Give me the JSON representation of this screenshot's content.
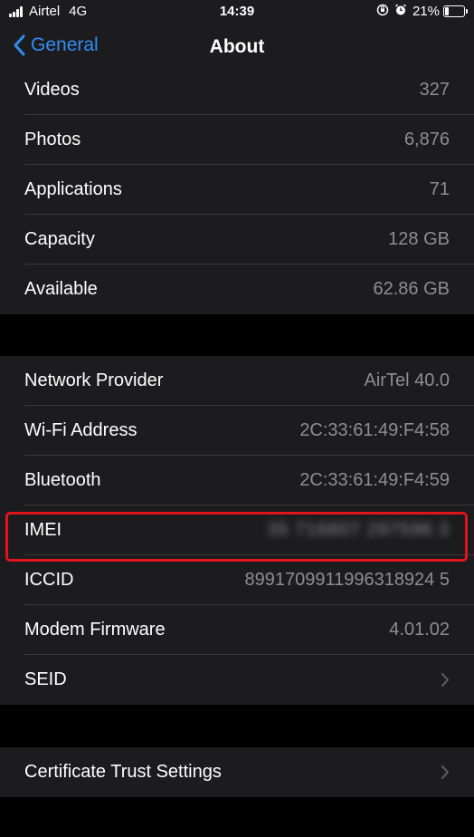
{
  "status_bar": {
    "carrier": "Airtel",
    "network": "4G",
    "time": "14:39",
    "battery_percent": "21%",
    "battery_level": 0.21
  },
  "nav": {
    "back_label": "General",
    "title": "About"
  },
  "storage_group": [
    {
      "label": "Videos",
      "value": "327"
    },
    {
      "label": "Photos",
      "value": "6,876"
    },
    {
      "label": "Applications",
      "value": "71"
    },
    {
      "label": "Capacity",
      "value": "128 GB"
    },
    {
      "label": "Available",
      "value": "62.86 GB"
    }
  ],
  "network_group": [
    {
      "label": "Network Provider",
      "value": "AirTel 40.0"
    },
    {
      "label": "Wi-Fi Address",
      "value": "2C:33:61:49:F4:58"
    },
    {
      "label": "Bluetooth",
      "value": "2C:33:61:49:F4:59"
    },
    {
      "label": "IMEI",
      "value": "35 716807 297596 3"
    },
    {
      "label": "ICCID",
      "value": "8991709911996318924 5"
    },
    {
      "label": "Modem Firmware",
      "value": "4.01.02"
    },
    {
      "label": "SEID",
      "value": ""
    }
  ],
  "certificate_group": [
    {
      "label": "Certificate Trust Settings"
    }
  ],
  "colors": {
    "accent": "#2f8df5",
    "highlight": "#e3131c",
    "cell_background": "#1c1c1e",
    "secondary_text": "#8e8e93"
  },
  "icons": {
    "back": "chevron-left-icon",
    "disclosure": "chevron-right-icon",
    "orientation_lock": "orientation-lock-icon",
    "alarm": "alarm-icon",
    "battery": "battery-icon",
    "signal": "signal-bars-icon"
  }
}
